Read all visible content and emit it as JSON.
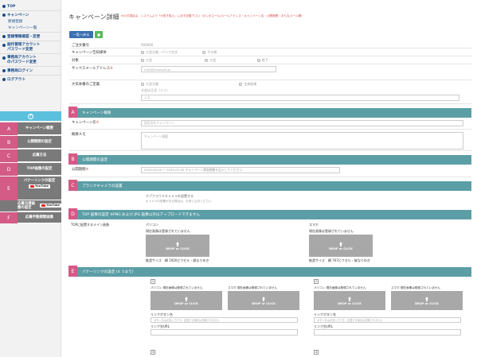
{
  "sidebar": {
    "top": "TOP",
    "campaign": "キャンペーン",
    "new_register": "新規登録",
    "campaign_list": "キャンペーン一覧",
    "registration_info": "登録情報確認・変更",
    "manager_account_1": "副作管理アカウント",
    "manager_account_2": "パスワード変更",
    "office_account_1": "事務局アカウント",
    "office_account_2": "のパスワード変更",
    "office_login": "事務局ログイン",
    "logout": "ログアウト",
    "plus": "+",
    "sections": [
      {
        "letter": "A",
        "label": "キャンペーン概要"
      },
      {
        "letter": "B",
        "label": "公開期間の設定"
      },
      {
        "letter": "C",
        "label": "応募方法"
      },
      {
        "letter": "D",
        "label": "TOP画像の設定"
      },
      {
        "letter": "E",
        "label": "バナーリンクの設定"
      },
      {
        "letter": "F",
        "label": "応募手動期間画像"
      }
    ],
    "youtube": "YouTube",
    "sub_entry": "応募当選画像の設定"
  },
  "header": {
    "title": "キャンペーン詳細",
    "note": "※の付項目は、システムより「※書き換え」に必ず記載下さい（ボンボスール/メールアドレス・キャンペーン名・公開期間・おもなメール欄）",
    "list_button": "一覧へ戻る",
    "green_button": "■"
  },
  "fields": {
    "request_no_label": "ご注文番号",
    "request_no_value": "000000",
    "media_label": "キャンペーン告知媒体",
    "media_opt1": "大会主催・パンフ注文",
    "media_opt2": "その他",
    "target_label": "対象",
    "target_opt1": "大会",
    "target_opt2": "大会",
    "target_opt3": "終了",
    "email_label": "サンクスメールアドレス",
    "email_value": "mail@example.jp",
    "contact_label": "大伝本番のご定義",
    "contact_opt1": "大会主催",
    "contact_opt2": "全体結果",
    "contact_detail": "大会は正式（ミニ）",
    "contact_input": "入力"
  },
  "sectionA": {
    "letter": "A",
    "title": "キャンペーン概要",
    "name_label": "キャンペーン名",
    "name_placeholder": "設定名をキャンペーン",
    "memo_label": "概要メモ",
    "memo_placeholder": "キャンペーン概要",
    "req_mark": "※"
  },
  "sectionB": {
    "letter": "B",
    "title": "公開期間の設定",
    "period_label": "公開期間",
    "period_value": "2020-00-00 〜 2020-07-00  キャンペーン実施期間を記入してください",
    "req_mark": "※"
  },
  "sectionC": {
    "letter": "C",
    "title": "ブランクキャメラの設置",
    "line1": "ホブクラウドキャメラを設置する",
    "line2": "キャメラの設置がある場合は、お申し込みください"
  },
  "sectionD": {
    "letter": "D",
    "title": "TOP 画像の設定 ※PNG および JPG 画像以外はアップロードできません",
    "main_label": "TOPに配置するメイン画像",
    "pc_label": "パソコン",
    "sp_label": "スマホ",
    "pc_unset": "現在画像は登録されていません",
    "sp_unset": "現在画像は登録されていません",
    "drop_label": "DROP or CLICK",
    "pc_size": "推奨サイズ　横 1920ピクセル・縦なりゆき",
    "sp_size": "推奨サイズ　横 767ピクセル・縦なりゆき"
  },
  "sectionE": {
    "letter": "E",
    "title": "バナーリンクの設定 (4 つまで)",
    "banners": [
      {
        "num": "1",
        "pc": "パソコン 現在画像は登録されていません",
        "sp": "スマホ 現在画像は登録されていません",
        "drop": "DROP or CLICK"
      },
      {
        "num": "2",
        "pc": "パソコン 現在画像は登録されていません",
        "sp": "スマホ 現在画像は登録されていません",
        "drop": "DROP or CLICK"
      },
      {
        "num": "3"
      },
      {
        "num": "4"
      }
    ],
    "link_btn_label": "リンクボタン名",
    "link_btn_placeholder": "ボタン名は必須入力です。記載する場合は省略されません",
    "link_url_label": "リンク先URL"
  }
}
